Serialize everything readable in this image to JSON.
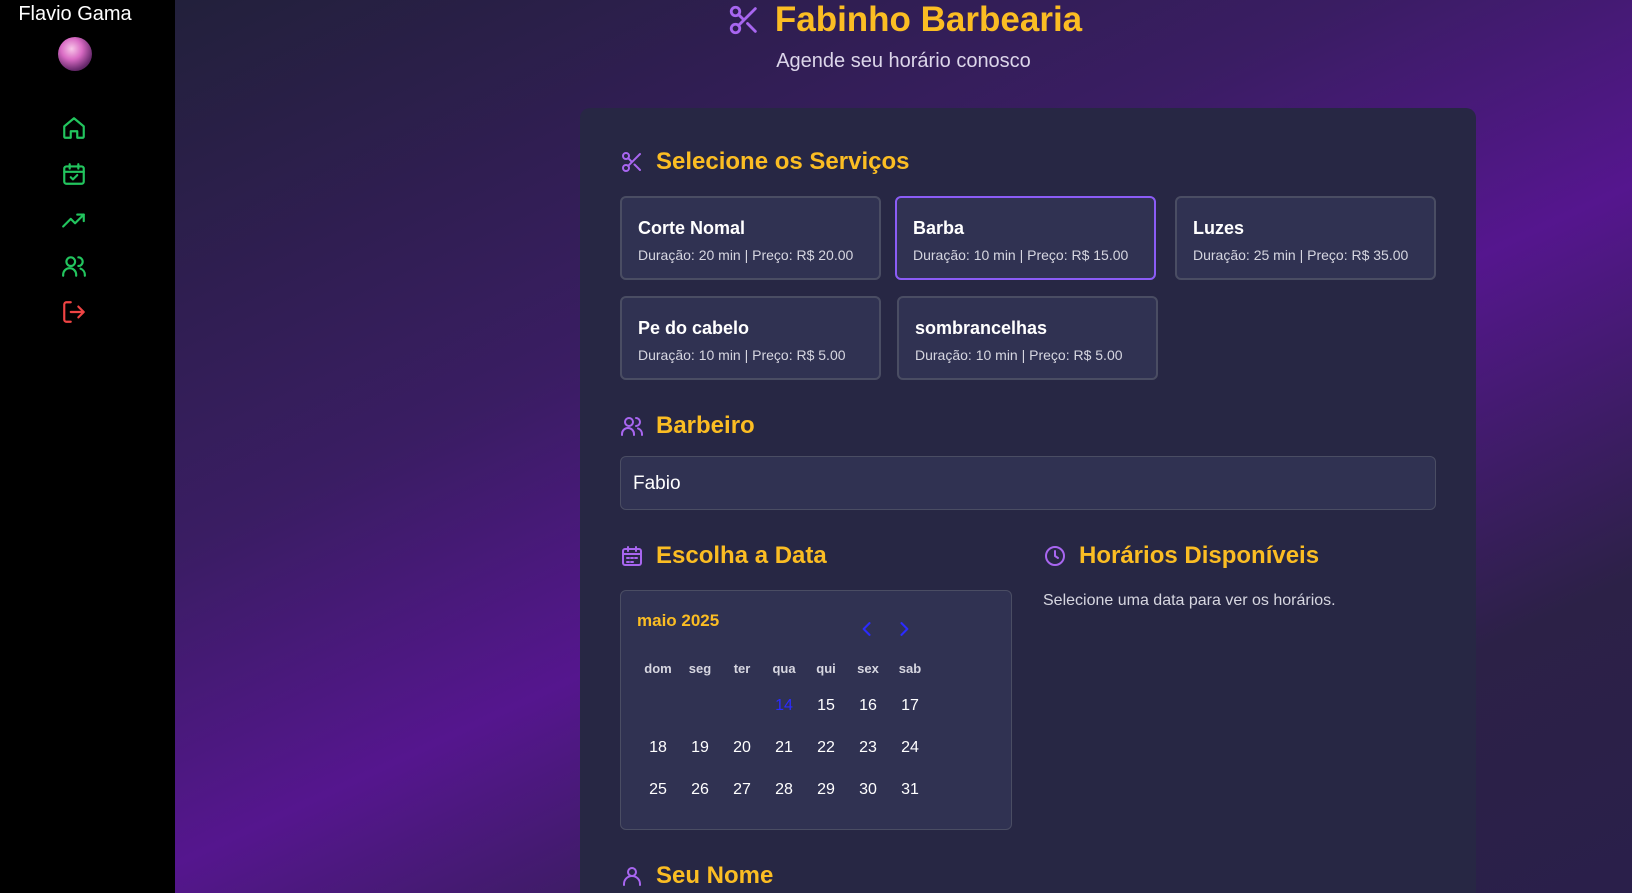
{
  "sidebar": {
    "user_name": "Flavio Gama",
    "nav": [
      {
        "icon": "home-icon",
        "color": "#22c55e"
      },
      {
        "icon": "calendar-check-icon",
        "color": "#22c55e"
      },
      {
        "icon": "trending-up-icon",
        "color": "#22c55e"
      },
      {
        "icon": "users-icon",
        "color": "#22c55e"
      },
      {
        "icon": "logout-icon",
        "color": "#ef4444"
      }
    ]
  },
  "header": {
    "title": "Fabinho Barbearia",
    "subtitle": "Agende seu horário conosco"
  },
  "services": {
    "title": "Selecione os Serviços",
    "items": [
      {
        "name": "Corte Nomal",
        "info": "Duração: 20 min | Preço: R$ 20.00",
        "selected": false
      },
      {
        "name": "Barba",
        "info": "Duração: 10 min | Preço: R$ 15.00",
        "selected": true
      },
      {
        "name": "Luzes",
        "info": "Duração: 25 min | Preço: R$ 35.00",
        "selected": false
      },
      {
        "name": "Pe do cabelo",
        "info": "Duração: 10 min | Preço: R$ 5.00",
        "selected": false
      },
      {
        "name": "sombrancelhas",
        "info": "Duração: 10 min | Preço: R$ 5.00",
        "selected": false
      }
    ]
  },
  "barber": {
    "title": "Barbeiro",
    "value": "Fabio"
  },
  "date": {
    "title": "Escolha a Data",
    "month": "maio 2025",
    "weekdays": [
      "dom",
      "seg",
      "ter",
      "qua",
      "qui",
      "sex",
      "sab"
    ],
    "today": "14",
    "weeks": [
      [
        "",
        "",
        "",
        "14",
        "15",
        "16",
        "17"
      ],
      [
        "18",
        "19",
        "20",
        "21",
        "22",
        "23",
        "24"
      ],
      [
        "25",
        "26",
        "27",
        "28",
        "29",
        "30",
        "31"
      ]
    ]
  },
  "slots": {
    "title": "Horários Disponíveis",
    "message": "Selecione uma data para ver os horários."
  },
  "name_section": {
    "title": "Seu Nome"
  },
  "colors": {
    "accent": "#fbbd23",
    "icon_purple": "#a866f0",
    "selected_border": "#8b5cf6"
  }
}
